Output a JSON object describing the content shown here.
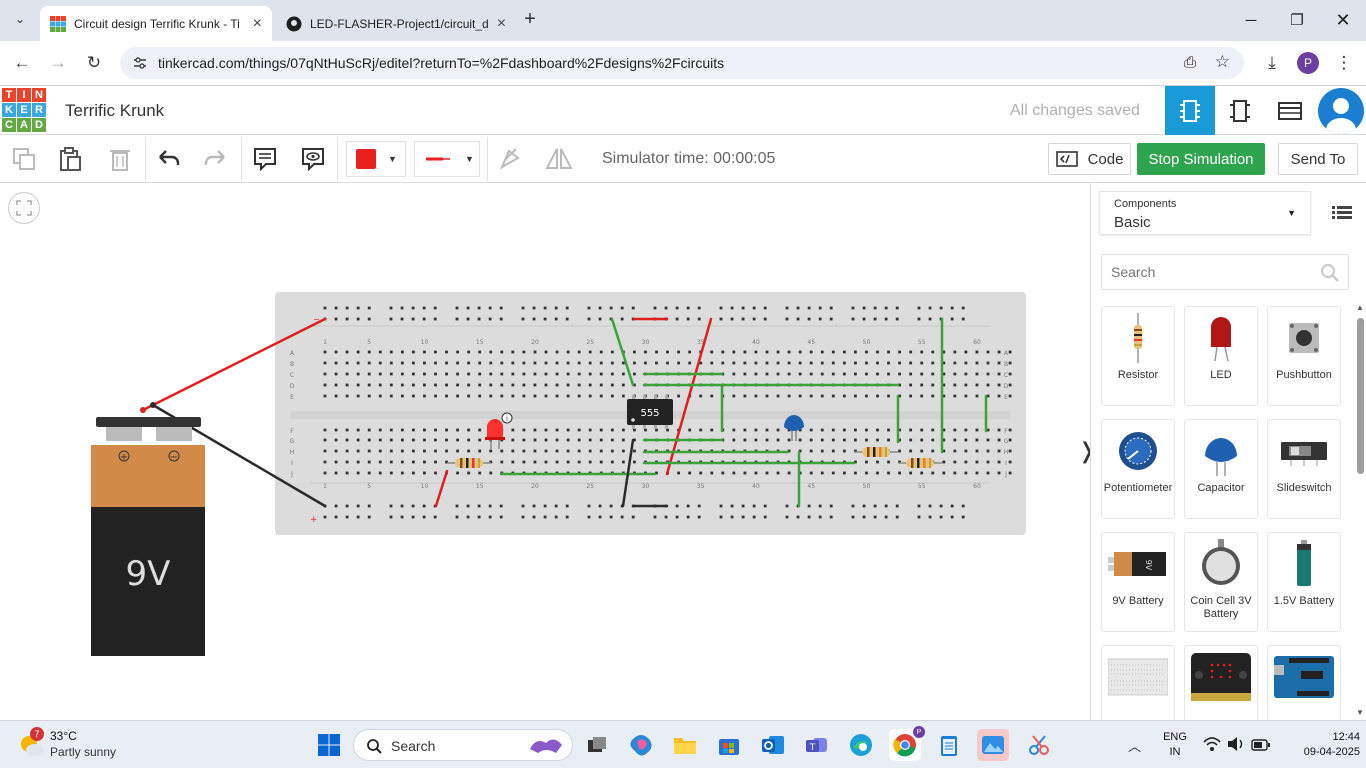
{
  "browser": {
    "tabs": [
      {
        "title": "Circuit design Terrific Krunk - Ti",
        "active": true
      },
      {
        "title": "LED-FLASHER-Project1/circuit_d",
        "active": false
      }
    ],
    "url": "tinkercad.com/things/07qNtHuScRj/editel?returnTo=%2Fdashboard%2Fdesigns%2Fcircuits",
    "profile_initial": "P"
  },
  "app": {
    "logo_letters": [
      "T",
      "I",
      "N",
      "K",
      "E",
      "R",
      "C",
      "A",
      "D"
    ],
    "logo_colors": [
      "#e8432b",
      "#e8432b",
      "#e8432b",
      "#3ca7dd",
      "#3ca7dd",
      "#3ca7dd",
      "#63a843",
      "#63a843",
      "#63a843"
    ],
    "design_name": "Terrific Krunk",
    "save_status": "All changes saved"
  },
  "toolbar": {
    "simulator_time": "Simulator time: 00:00:05",
    "code_label": "Code",
    "stop_label": "Stop Simulation",
    "send_label": "Send To",
    "fill_color": "#e8201e",
    "wire_color": "#e8201e"
  },
  "canvas": {
    "battery_label": "9V",
    "chip_label": "555",
    "row_labels": [
      "A",
      "B",
      "C",
      "D",
      "E",
      "F",
      "G",
      "H",
      "I",
      "J"
    ],
    "col_numbers": [
      "1",
      "5",
      "10",
      "15",
      "20",
      "25",
      "30",
      "35",
      "40",
      "45",
      "50",
      "55",
      "60"
    ]
  },
  "panel": {
    "components_title": "Components",
    "components_value": "Basic",
    "search_placeholder": "Search",
    "items": [
      {
        "label": "Resistor"
      },
      {
        "label": "LED"
      },
      {
        "label": "Pushbutton"
      },
      {
        "label": "Potentiometer"
      },
      {
        "label": "Capacitor"
      },
      {
        "label": "Slideswitch"
      },
      {
        "label": "9V Battery"
      },
      {
        "label": "Coin Cell 3V Battery"
      },
      {
        "label": "1.5V Battery"
      }
    ]
  },
  "taskbar": {
    "weather_temp": "33°C",
    "weather_desc": "Partly sunny",
    "weather_badge": "7",
    "search_label": "Search",
    "lang_top": "ENG",
    "lang_bottom": "IN",
    "time": "12:44",
    "date": "09-04-2025"
  }
}
